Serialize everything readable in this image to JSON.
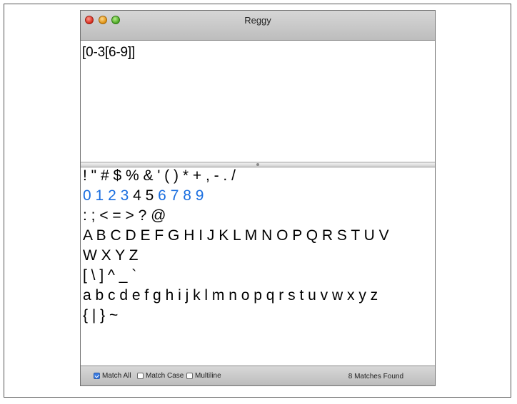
{
  "window": {
    "title": "Reggy"
  },
  "regex": {
    "pattern": "[0-3[6-9]]"
  },
  "test_text": {
    "lines": [
      {
        "segments": [
          {
            "t": "! \" # $ % & ' ( ) * + , - . /",
            "m": false
          }
        ]
      },
      {
        "segments": [
          {
            "t": "0",
            "m": true
          },
          {
            "t": " ",
            "m": false
          },
          {
            "t": "1",
            "m": true
          },
          {
            "t": " ",
            "m": false
          },
          {
            "t": "2",
            "m": true
          },
          {
            "t": " ",
            "m": false
          },
          {
            "t": "3",
            "m": true
          },
          {
            "t": " 4 5 ",
            "m": false
          },
          {
            "t": "6",
            "m": true
          },
          {
            "t": " ",
            "m": false
          },
          {
            "t": "7",
            "m": true
          },
          {
            "t": " ",
            "m": false
          },
          {
            "t": "8",
            "m": true
          },
          {
            "t": " ",
            "m": false
          },
          {
            "t": "9",
            "m": true
          }
        ]
      },
      {
        "segments": [
          {
            "t": ": ; < = > ? @",
            "m": false
          }
        ]
      },
      {
        "segments": [
          {
            "t": "A B C D E F G H I J K L M N O P Q R S T U V",
            "m": false
          }
        ]
      },
      {
        "segments": [
          {
            "t": "W X Y Z",
            "m": false
          }
        ]
      },
      {
        "segments": [
          {
            "t": "[ \\ ] ^ _ `",
            "m": false
          }
        ]
      },
      {
        "segments": [
          {
            "t": "a b c d e f g h i j k l m n o p q r s t u v w x y z",
            "m": false
          }
        ]
      },
      {
        "segments": [
          {
            "t": "{ | } ~",
            "m": false
          }
        ]
      }
    ]
  },
  "status": {
    "options": [
      {
        "label": "Match All",
        "checked": true
      },
      {
        "label": "Match Case",
        "checked": false
      },
      {
        "label": "Multiline",
        "checked": false
      }
    ],
    "matches": "8 Matches Found"
  },
  "colors": {
    "match_highlight": "#1a6ee0"
  }
}
